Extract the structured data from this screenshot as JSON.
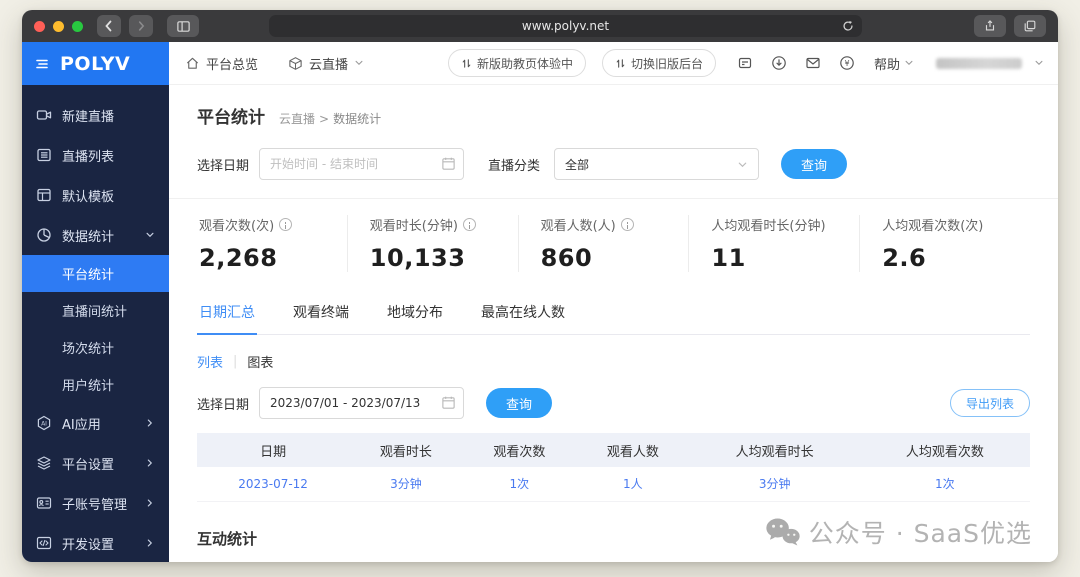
{
  "browser": {
    "url": "www.polyv.net"
  },
  "brand": {
    "name": "POLYV"
  },
  "topbar": {
    "nav_overview": "平台总览",
    "nav_product": "云直播",
    "pill_new_assistant": "新版助教页体验中",
    "pill_switch_old": "切换旧版后台",
    "help_label": "帮助"
  },
  "icons": {
    "ai_glyph": "AI",
    "currency_glyph": "¥"
  },
  "sidebar": {
    "items": [
      {
        "label": "新建直播",
        "icon": "camera-icon"
      },
      {
        "label": "直播列表",
        "icon": "list-icon"
      },
      {
        "label": "默认模板",
        "icon": "template-icon"
      },
      {
        "label": "数据统计",
        "icon": "pie-chart-icon"
      }
    ],
    "subitems": [
      {
        "label": "平台统计",
        "active": true
      },
      {
        "label": "直播间统计"
      },
      {
        "label": "场次统计"
      },
      {
        "label": "用户统计"
      }
    ],
    "bottom_items": [
      {
        "label": "AI应用",
        "icon": "ai-icon"
      },
      {
        "label": "平台设置",
        "icon": "layers-icon"
      },
      {
        "label": "子账号管理",
        "icon": "id-card-icon"
      },
      {
        "label": "开发设置",
        "icon": "code-icon"
      }
    ]
  },
  "page": {
    "title": "平台统计",
    "breadcrumb": {
      "parent": "云直播",
      "separator": ">",
      "current": "数据统计"
    },
    "filter": {
      "date_label": "选择日期",
      "date_placeholder": "开始时间 - 结束时间",
      "category_label": "直播分类",
      "category_value": "全部",
      "search_label": "查询"
    },
    "stats": [
      {
        "label": "观看次数(次)",
        "value": "2,268"
      },
      {
        "label": "观看时长(分钟)",
        "value": "10,133"
      },
      {
        "label": "观看人数(人)",
        "value": "860"
      },
      {
        "label": "人均观看时长(分钟)",
        "value": "11"
      },
      {
        "label": "人均观看次数(次)",
        "value": "2.6"
      }
    ],
    "tabs": [
      {
        "label": "日期汇总",
        "active": true
      },
      {
        "label": "观看终端"
      },
      {
        "label": "地域分布"
      },
      {
        "label": "最高在线人数"
      }
    ],
    "view_toggle": {
      "list": "列表",
      "separator": "|",
      "chart": "图表"
    },
    "filter2": {
      "date_label": "选择日期",
      "date_value": "2023/07/01 - 2023/07/13",
      "search_label": "查询",
      "export_label": "导出列表"
    },
    "table": {
      "headers": [
        "日期",
        "观看时长",
        "观看次数",
        "观看人数",
        "人均观看时长",
        "人均观看次数"
      ],
      "rows": [
        [
          "2023-07-12",
          "3分钟",
          "1次",
          "1人",
          "3分钟",
          "1次"
        ]
      ]
    },
    "section2_title": "互动统计",
    "watermark_text": "公众号 · SaaS优选"
  }
}
